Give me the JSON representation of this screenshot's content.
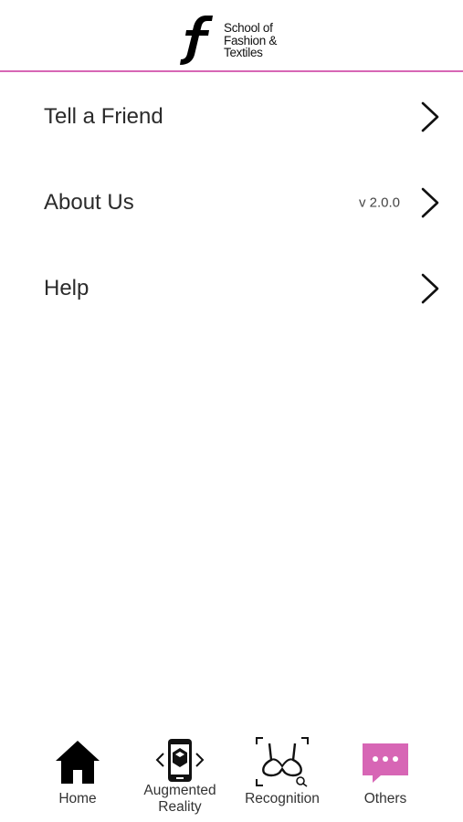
{
  "header": {
    "logo_lines": [
      "School of",
      "Fashion &",
      "Textiles"
    ],
    "divider_color": "#d766b5"
  },
  "menu": {
    "items": [
      {
        "label": "Tell a Friend",
        "icon": "chevron-right-icon"
      },
      {
        "label": "About Us",
        "version": "v 2.0.0",
        "icon": "chevron-right-icon"
      },
      {
        "label": "Help",
        "icon": "chevron-right-icon"
      }
    ]
  },
  "tabbar": {
    "tabs": [
      {
        "label": "Home",
        "icon": "home-icon"
      },
      {
        "label_line1": "Augmented",
        "label_line2": "Reality",
        "icon": "ar-phone-icon"
      },
      {
        "label": "Recognition",
        "icon": "garment-scan-icon"
      },
      {
        "label": "Others",
        "icon": "chat-bubble-icon",
        "active": true,
        "accent": "#d766b5"
      }
    ]
  }
}
